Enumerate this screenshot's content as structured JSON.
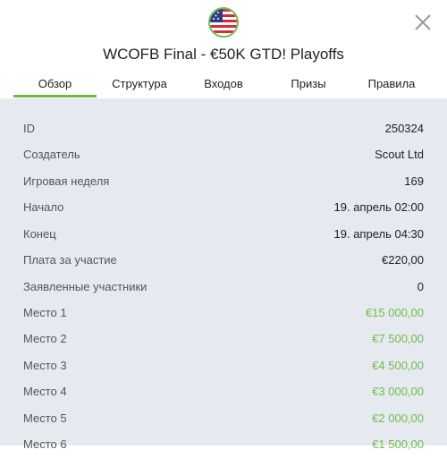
{
  "header": {
    "flag_icon": "us-flag-icon",
    "title": "WCOFB Final - €50K GTD! Playoffs",
    "close_icon": "close-icon"
  },
  "tabs": [
    {
      "label": "Обзор",
      "active": true
    },
    {
      "label": "Структура",
      "active": false
    },
    {
      "label": "Входов",
      "active": false
    },
    {
      "label": "Призы",
      "active": false
    },
    {
      "label": "Правила",
      "active": false
    }
  ],
  "details": [
    {
      "label": "ID",
      "value": "250324"
    },
    {
      "label": "Создатель",
      "value": "Scout Ltd"
    },
    {
      "label": "Игровая неделя",
      "value": "169"
    },
    {
      "label": "Начало",
      "value": "19. апрель 02:00"
    },
    {
      "label": "Конец",
      "value": "19. апрель 04:30"
    },
    {
      "label": "Плата за участие",
      "value": "€220,00"
    },
    {
      "label": "Заявленные участники",
      "value": "0"
    }
  ],
  "prizes": [
    {
      "label": "Место 1",
      "value": "€15 000,00"
    },
    {
      "label": "Место 2",
      "value": "€7 500,00"
    },
    {
      "label": "Место 3",
      "value": "€4 500,00"
    },
    {
      "label": "Место 4",
      "value": "€3 000,00"
    },
    {
      "label": "Место 5",
      "value": "€2 000,00"
    },
    {
      "label": "Место 6",
      "value": "€1 500,00"
    }
  ],
  "colors": {
    "accent": "#6cc04a",
    "content_bg": "#e6e9ef"
  }
}
